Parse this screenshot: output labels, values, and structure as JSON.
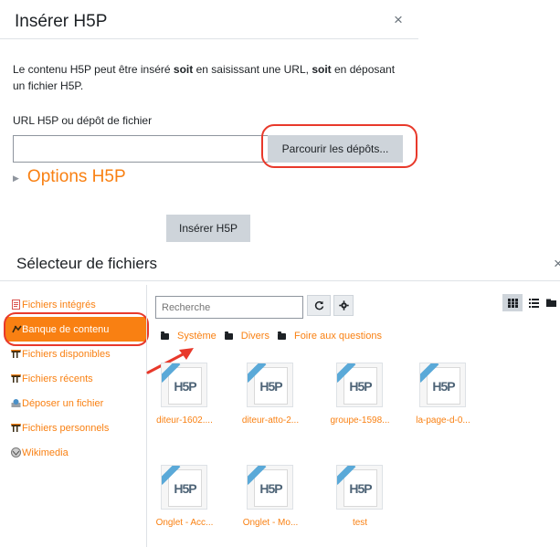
{
  "dialog": {
    "title": "Insérer H5P",
    "close_glyph": "×",
    "intro_part1": "Le contenu H5P peut être inséré ",
    "intro_bold1": "soit",
    "intro_part2": " en saisissant une URL, ",
    "intro_bold2": "soit",
    "intro_part3": " en déposant un fichier H5P.",
    "field_label": "URL H5P ou dépôt de fichier",
    "url_value": "",
    "browse_label": "Parcourir les dépôts...",
    "options_label": "Options H5P",
    "insert_label": "Insérer H5P"
  },
  "file_picker": {
    "title": "Sélecteur de fichiers",
    "close_glyph": "×",
    "repositories": [
      {
        "label": "Fichiers intégrés",
        "icon": "document-icon",
        "active": false
      },
      {
        "label": "Banque de contenu",
        "icon": "content-bank-icon",
        "active": true
      },
      {
        "label": "Fichiers disponibles",
        "icon": "files-icon",
        "active": false
      },
      {
        "label": "Fichiers récents",
        "icon": "recent-files-icon",
        "active": false
      },
      {
        "label": "Déposer un fichier",
        "icon": "upload-icon",
        "active": false
      },
      {
        "label": "Fichiers personnels",
        "icon": "private-files-icon",
        "active": false
      },
      {
        "label": "Wikimedia",
        "icon": "wikimedia-icon",
        "active": false
      }
    ],
    "search_placeholder": "Recherche",
    "toolbar": {
      "refresh_icon": "refresh-icon",
      "settings_icon": "gear-icon"
    },
    "views": {
      "icons": "grid-view-icon",
      "list": "list-view-icon",
      "tree": "tree-view-icon"
    },
    "breadcrumb": [
      "Système",
      "Divers",
      "Foire aux questions"
    ],
    "files": [
      {
        "name": "diteur-1602...."
      },
      {
        "name": "diteur-atto-2..."
      },
      {
        "name": "groupe-1598..."
      },
      {
        "name": "la-page-d-0..."
      },
      {
        "name": "Onglet - Acc..."
      },
      {
        "name": "Onglet - Mo..."
      },
      {
        "name": "test"
      }
    ],
    "thumb_logo": "H5P"
  },
  "colors": {
    "accent": "#f98012",
    "highlight": "#e8392b",
    "text": "#1d2125"
  }
}
